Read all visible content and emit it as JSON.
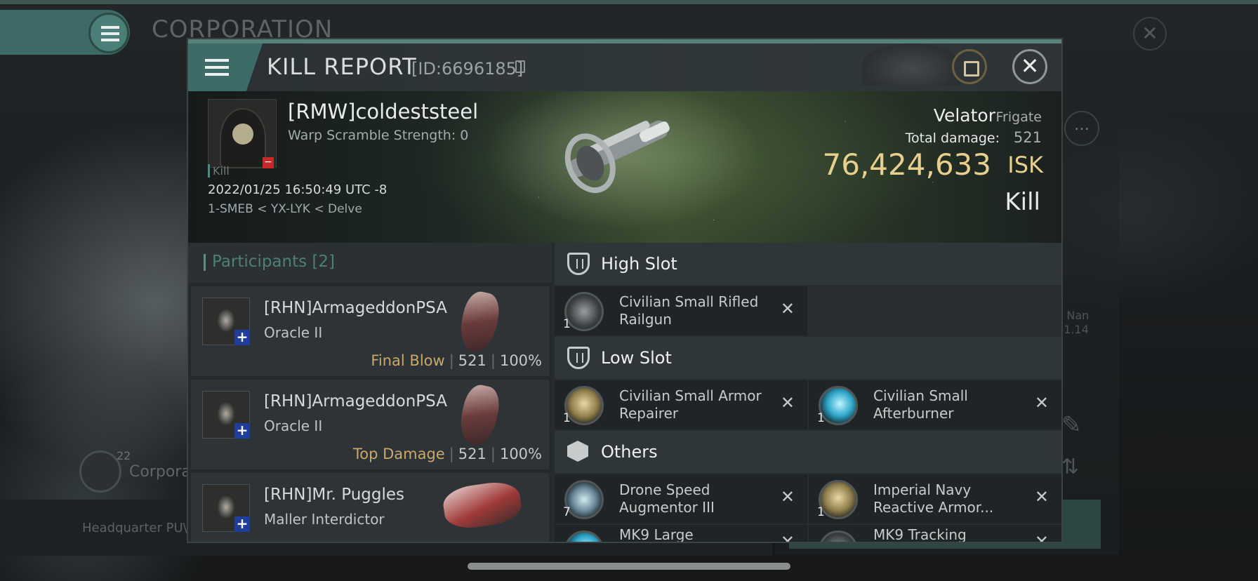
{
  "background": {
    "title": "CORPORATION",
    "corp_label": "Corpora",
    "corp_count": "22",
    "hq_label": "Headquarter PU\\",
    "side_text": "le Nan\n.11.14"
  },
  "header": {
    "title": "KILL REPORT",
    "id_text": "[ID:6696185]"
  },
  "victim": {
    "name": "[RMW]coldeststeel",
    "warp": "Warp Scramble Strength: 0",
    "tag": "Kill",
    "time": "2022/01/25 16:50:49 UTC -8",
    "location": "1-SMEB < YX-LYK < Delve",
    "ship_name": "Velator",
    "ship_class": "Frigate",
    "damage_label": "Total damage:",
    "damage_value": "521",
    "isk_value": "76,424,633",
    "isk_unit": "ISK",
    "result": "Kill"
  },
  "participants": {
    "title": "Participants [2]",
    "rows": [
      {
        "name": "[RHN]ArmageddonPSA",
        "ship": "Oracle II",
        "tag": "Final Blow",
        "damage": "521",
        "percent": "100%"
      },
      {
        "name": "[RHN]ArmageddonPSA",
        "ship": "Oracle II",
        "tag": "Top Damage",
        "damage": "521",
        "percent": "100%"
      },
      {
        "name": "[RHN]Mr. Puggles",
        "ship": "Maller Interdictor"
      }
    ]
  },
  "fitting": {
    "high": {
      "title": "High Slot",
      "modules": [
        {
          "name": "Civilian Small Rifled Railgun",
          "qty": "1"
        }
      ]
    },
    "low": {
      "title": "Low Slot",
      "modules": [
        {
          "name": "Civilian Small Armor Repairer",
          "qty": "1"
        },
        {
          "name": "Civilian Small Afterburner",
          "qty": "1"
        }
      ]
    },
    "others": {
      "title": "Others",
      "modules": [
        {
          "name": "Drone Speed Augmentor III",
          "qty": "7"
        },
        {
          "name": "Imperial Navy Reactive Armor...",
          "qty": "1"
        },
        {
          "name": "MK9 Large"
        },
        {
          "name": "MK9 Tracking"
        }
      ]
    }
  },
  "colors": {
    "accent": "#3d6b67",
    "isk": "#e9cf8d",
    "tag": "#c9a86a",
    "badge_blue": "#1f3d9a",
    "badge_red": "#c52a2a"
  }
}
